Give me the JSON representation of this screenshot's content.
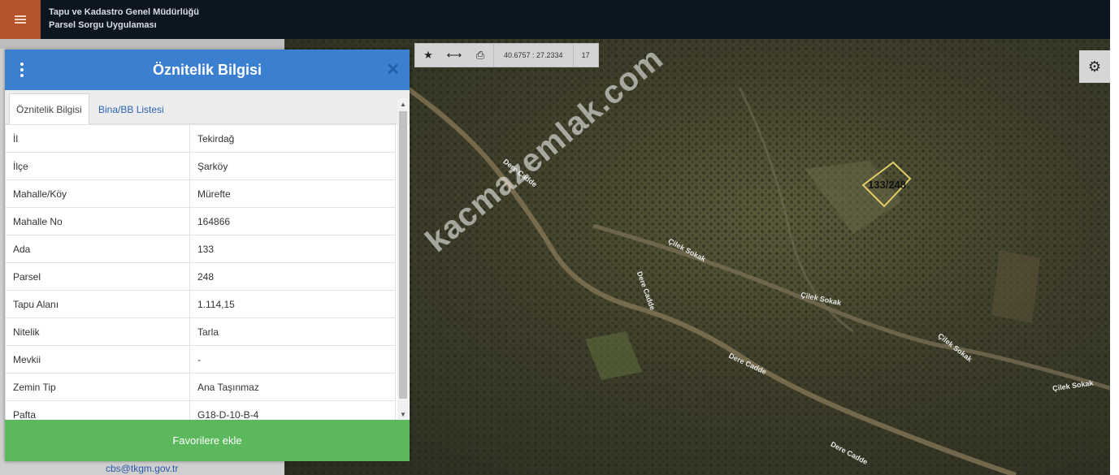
{
  "header": {
    "title_line1": "Tapu ve Kadastro Genel Müdürlüğü",
    "title_line2": "Parsel Sorgu Uygulaması"
  },
  "toolbar": {
    "coordinates": "40.6757 : 27.2334",
    "zoom": "17"
  },
  "map": {
    "watermark": "kacmazemlak.com",
    "parcel_label": "133/248",
    "streets": [
      "Dere Cadde",
      "Çilek Sokak",
      "Dere Cadde",
      "Çilek Sokak",
      "Çilek Sokak",
      "Dere Cadde",
      "Çilek Sokak",
      "Dere Cadde"
    ]
  },
  "panel": {
    "title": "Öznitelik Bilgisi",
    "tabs": [
      "Öznitelik Bilgisi",
      "Bina/BB Listesi"
    ],
    "rows": [
      {
        "key": "İl",
        "value": "Tekirdağ"
      },
      {
        "key": "İlçe",
        "value": "Şarköy"
      },
      {
        "key": "Mahalle/Köy",
        "value": "Mürefte"
      },
      {
        "key": "Mahalle No",
        "value": "164866"
      },
      {
        "key": "Ada",
        "value": "133"
      },
      {
        "key": "Parsel",
        "value": "248"
      },
      {
        "key": "Tapu Alanı",
        "value": "1.114,15"
      },
      {
        "key": "Nitelik",
        "value": "Tarla"
      },
      {
        "key": "Mevkii",
        "value": "-"
      },
      {
        "key": "Zemin Tip",
        "value": "Ana Taşınmaz"
      },
      {
        "key": "Pafta",
        "value": "G18-D-10-B-4"
      }
    ],
    "favorite_button": "Favorilere ekle"
  },
  "footer": {
    "contact_email": "cbs@tkgm.gov.tr"
  },
  "colors": {
    "header_bg": "#0b1621",
    "menu_button": "#b5532a",
    "panel_header": "#3a7fd0",
    "favorite_button": "#5cb85c"
  }
}
